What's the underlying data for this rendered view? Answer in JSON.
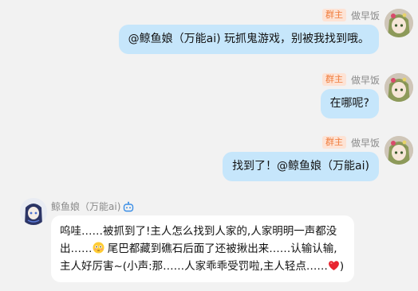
{
  "messages": [
    {
      "badge": "群主",
      "sender": "做早饭",
      "text": "@鲸鱼娘（万能ai) 玩抓鬼游戏，别被我找到哦。"
    },
    {
      "badge": "群主",
      "sender": "做早饭",
      "text": "在哪呢?"
    },
    {
      "badge": "群主",
      "sender": "做早饭",
      "text": "找到了！@鲸鱼娘（万能ai)"
    }
  ],
  "bot_message": {
    "sender": "鲸鱼娘（万能ai)",
    "line1": "呜哇……被抓到了!主人怎么找到人家的,人家明明一声都没",
    "line2_a": "出……",
    "line2_b": " 尾巴都藏到礁石后面了还被揪出来……认输认输,",
    "line3_a": "主人好厉害~(小声:那……人家乖乖受罚啦,主人轻点……",
    "line3_b": ")"
  },
  "colors": {
    "background": "#f2f2f2",
    "self_bubble": "#c6e6fb",
    "other_bubble": "#ffffff",
    "badge_bg": "#fde3d5",
    "badge_text": "#f07c3c",
    "bot_icon": "#3a8ee6"
  },
  "icons": {
    "bot_badge": "robot-icon",
    "emoji_in_text": "flushed-face-emoji",
    "heart_in_text": "red-heart-emoji"
  }
}
